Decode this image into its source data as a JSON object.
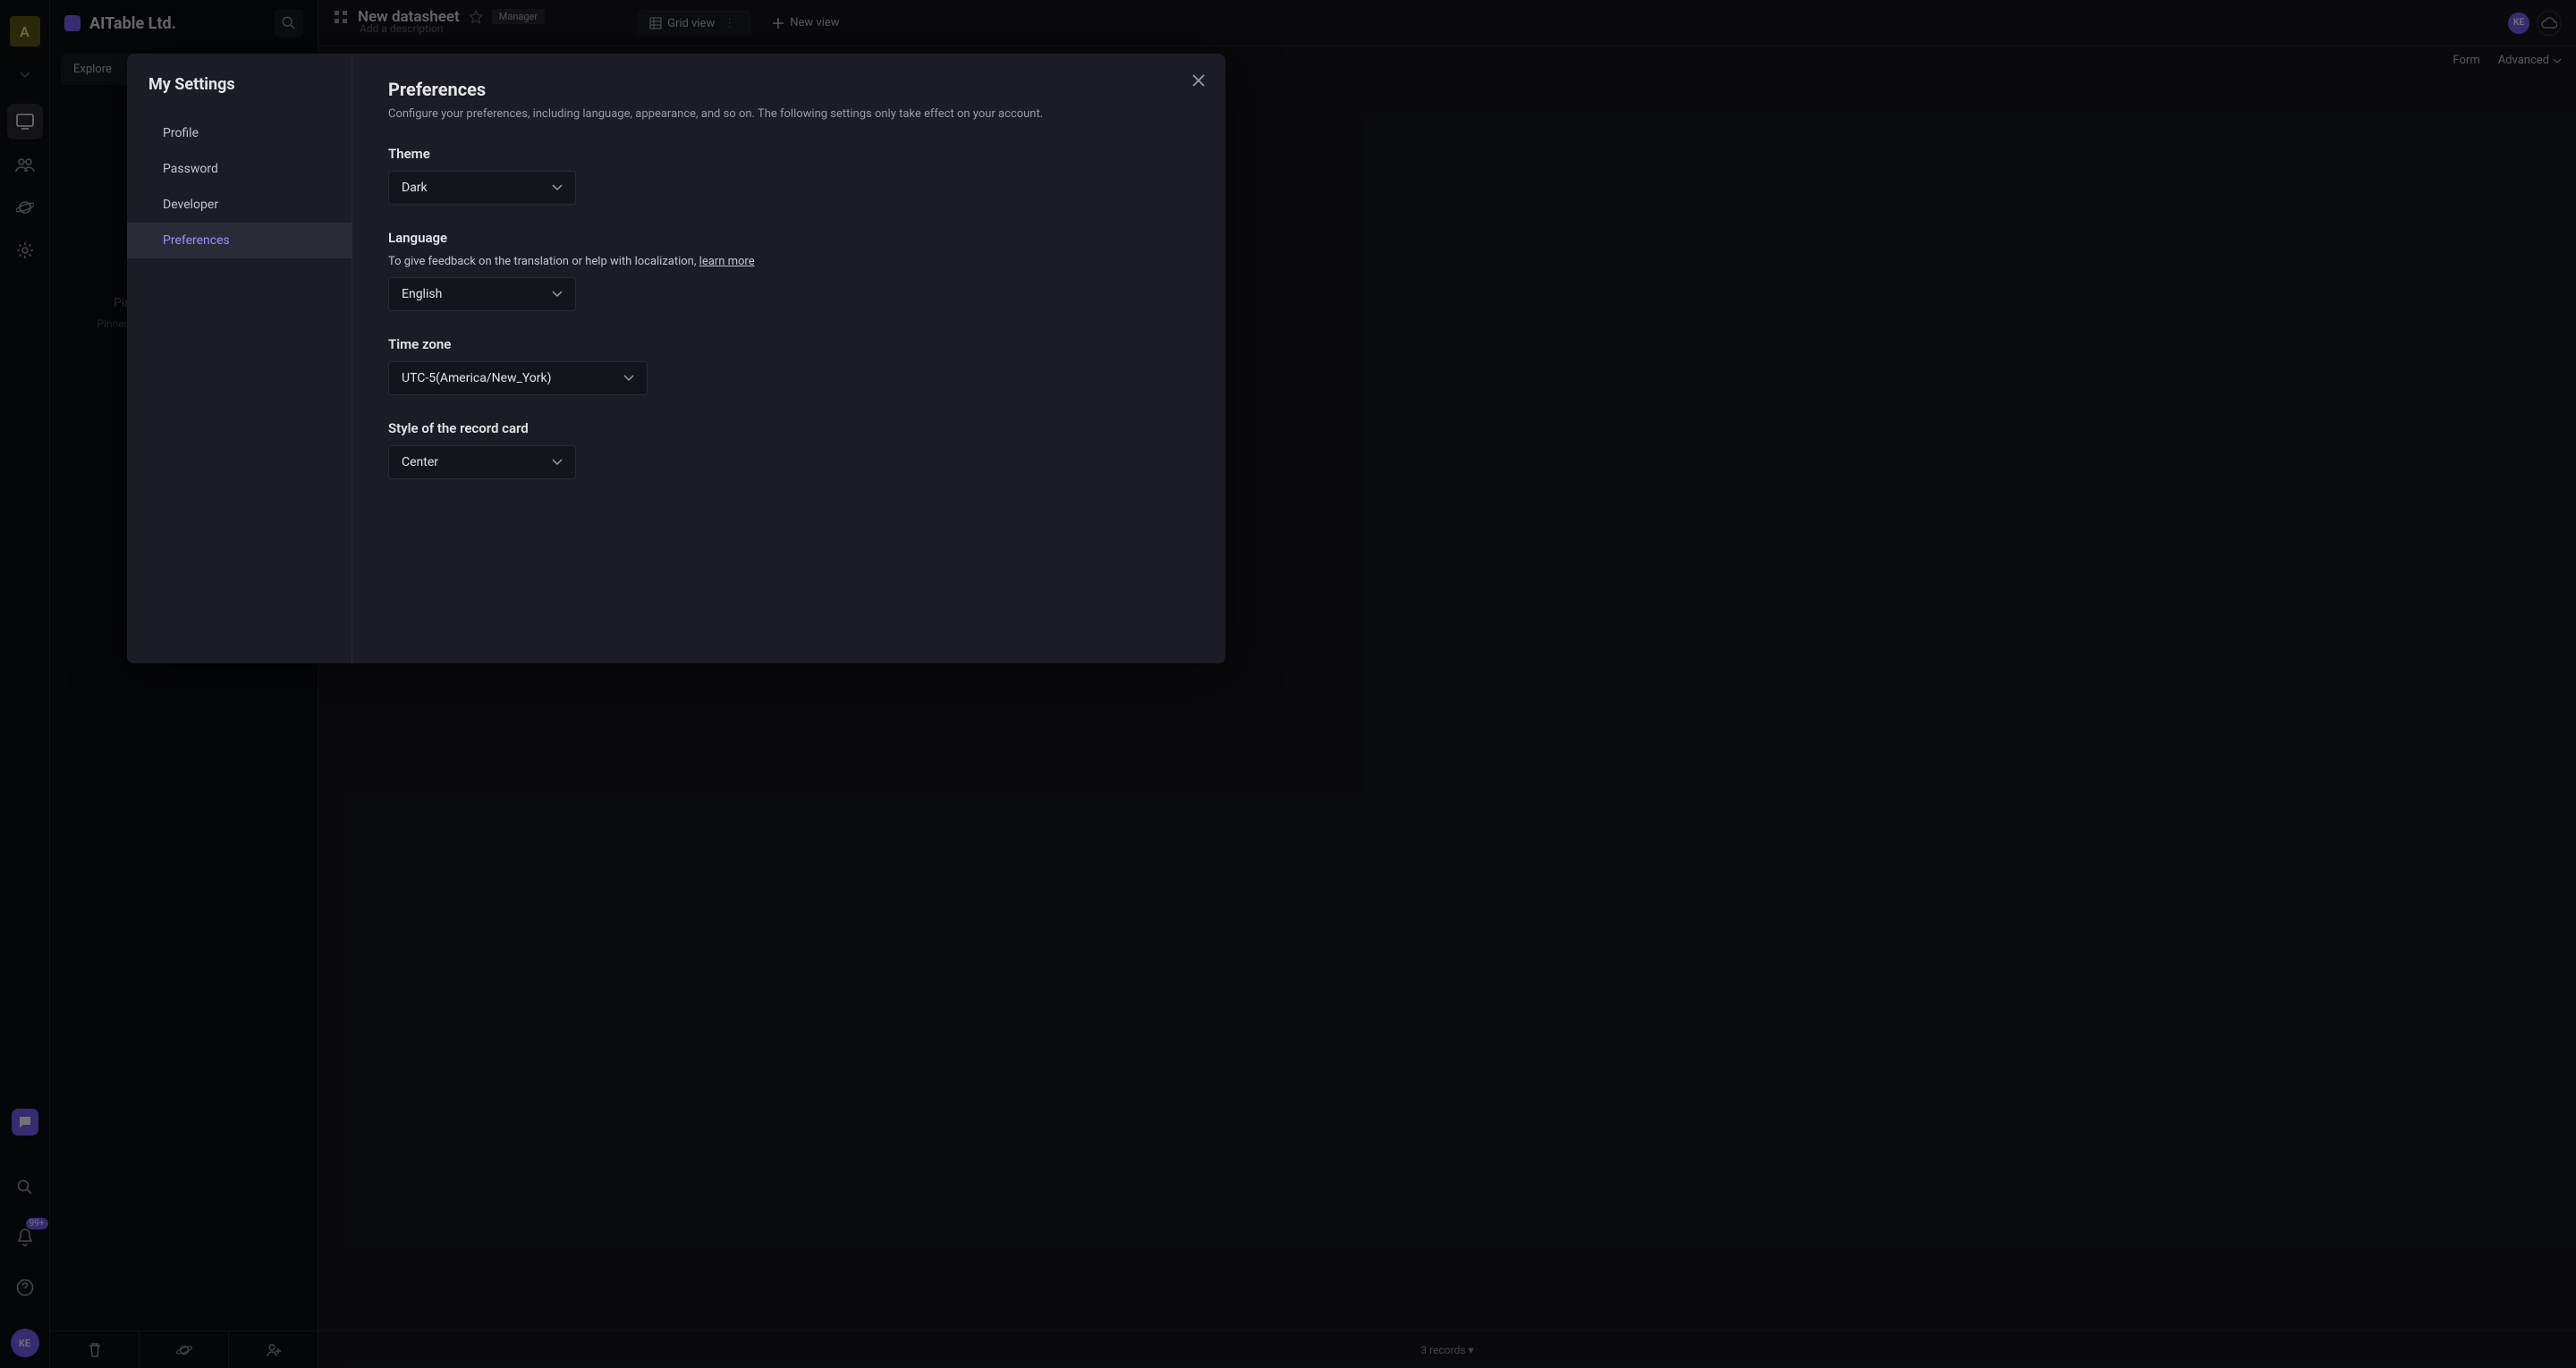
{
  "workspace": {
    "initial": "A",
    "name": "AITable Ltd."
  },
  "sidebar": {
    "explore_label": "Explore",
    "pin_title": "Pin important nodes here",
    "pin_subtitle": "Pinned nodes only visible to yourself"
  },
  "rail": {
    "notification_badge": "99+",
    "avatar": "KE"
  },
  "header": {
    "datasheet_title": "New datasheet",
    "role_badge": "Manager",
    "description_placeholder": "Add a description",
    "grid_view_label": "Grid view",
    "new_view_label": "New view",
    "avatar": "KE"
  },
  "toolbar": {
    "form_label": "Form",
    "advanced_label": "Advanced"
  },
  "footer": {
    "records_label": "3 records"
  },
  "modal": {
    "title": "My Settings",
    "nav": {
      "profile": "Profile",
      "password": "Password",
      "developer": "Developer",
      "preferences": "Preferences"
    },
    "content": {
      "heading": "Preferences",
      "description": "Configure your preferences, including language, appearance, and so on. The following settings only take effect on your account.",
      "theme": {
        "label": "Theme",
        "value": "Dark"
      },
      "language": {
        "label": "Language",
        "help_prefix": "To give feedback on the translation or help with localization, ",
        "help_link": "learn more",
        "value": "English"
      },
      "timezone": {
        "label": "Time zone",
        "value": "UTC-5(America/New_York)"
      },
      "record_card": {
        "label": "Style of the record card",
        "value": "Center"
      }
    }
  }
}
